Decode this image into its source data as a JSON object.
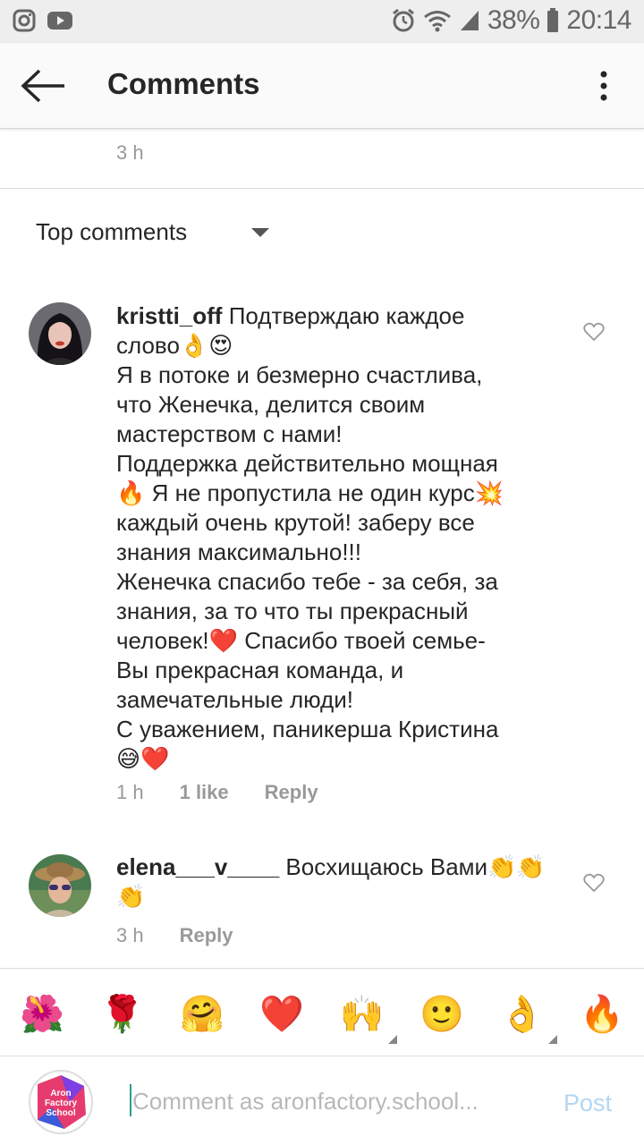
{
  "status_bar": {
    "battery": "38%",
    "time": "20:14"
  },
  "header": {
    "title": "Comments"
  },
  "first_time": "3 h",
  "sort": {
    "label": "Top comments"
  },
  "comments": [
    {
      "username": "kristti_off",
      "lines": [
        "Подтверждаю каждое",
        "слово👌😍",
        "Я в потоке и безмерно счастлива,",
        "что Женечка, делится своим",
        "мастерством с нами!",
        "Поддержка действительно мощная",
        "🔥 Я не пропустила не один курс💥",
        "каждый очень крутой! заберу все",
        "знания максимально!!!",
        "Женечка спасибо тебе - за себя, за",
        "знания, за то что ты прекрасный",
        "человек!❤️ Спасибо твоей семье-",
        "Вы прекрасная команда, и",
        "замечательные люди!",
        "С  уважением, паникерша Кристина",
        "😅❤️"
      ],
      "time": "1 h",
      "likes": "1 like",
      "reply": "Reply"
    },
    {
      "username": "elena___v____",
      "lines": [
        "Восхищаюсь Вами👏👏",
        "👏"
      ],
      "time": "3 h",
      "reply": "Reply"
    }
  ],
  "emoji_bar": [
    "🌺",
    "🌹",
    "🤗",
    "❤️",
    "🙌",
    "🙂",
    "👌",
    "🔥"
  ],
  "composer": {
    "avatar_text": "Aron Factory School",
    "placeholder": "Comment as aronfactory.school...",
    "post_label": "Post"
  },
  "colors": {
    "accent": "#b4d6f2",
    "cursor": "#2a9d8f"
  }
}
